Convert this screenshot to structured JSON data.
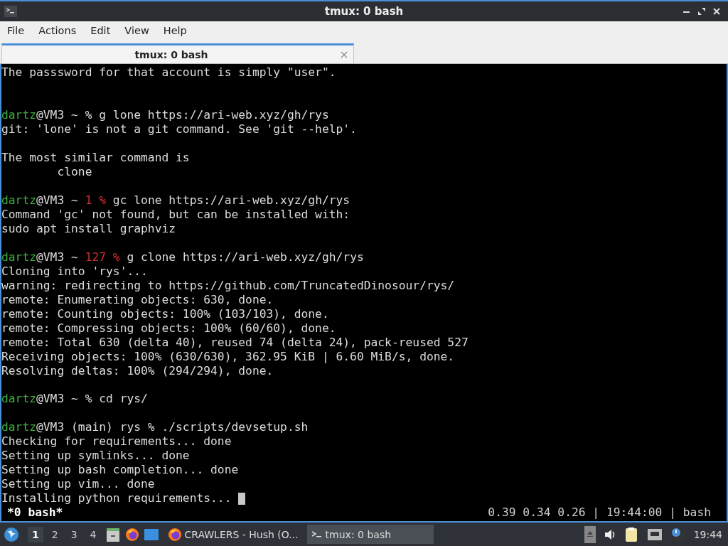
{
  "window": {
    "title": "tmux: 0 bash"
  },
  "menu": [
    "File",
    "Actions",
    "Edit",
    "View",
    "Help"
  ],
  "tabs": [
    {
      "label": "tmux: 0 bash",
      "selected": true
    }
  ],
  "terminal": {
    "lines": [
      {
        "kind": "text",
        "segments": [
          {
            "kind": "plain",
            "text": "The passsword for that account is simply \"user\"."
          }
        ]
      },
      {
        "kind": "blank"
      },
      {
        "kind": "blank"
      },
      {
        "kind": "text",
        "segments": [
          {
            "kind": "user",
            "text": "dartz"
          },
          {
            "kind": "plain",
            "text": "@VM3 ~ % g lone https://ari-web.xyz/gh/rys"
          }
        ]
      },
      {
        "kind": "text",
        "segments": [
          {
            "kind": "plain",
            "text": "git: 'lone' is not a git command. See 'git --help'."
          }
        ]
      },
      {
        "kind": "blank"
      },
      {
        "kind": "text",
        "segments": [
          {
            "kind": "plain",
            "text": "The most similar command is"
          }
        ]
      },
      {
        "kind": "text",
        "segments": [
          {
            "kind": "plain",
            "text": "        clone"
          }
        ]
      },
      {
        "kind": "blank"
      },
      {
        "kind": "text",
        "segments": [
          {
            "kind": "user",
            "text": "dartz"
          },
          {
            "kind": "plain",
            "text": "@VM3 ~ "
          },
          {
            "kind": "error",
            "text": "1 %"
          },
          {
            "kind": "plain",
            "text": " gc lone https://ari-web.xyz/gh/rys"
          }
        ]
      },
      {
        "kind": "text",
        "segments": [
          {
            "kind": "plain",
            "text": "Command 'gc' not found, but can be installed with:"
          }
        ]
      },
      {
        "kind": "text",
        "segments": [
          {
            "kind": "plain",
            "text": "sudo apt install graphviz"
          }
        ]
      },
      {
        "kind": "blank"
      },
      {
        "kind": "text",
        "segments": [
          {
            "kind": "user",
            "text": "dartz"
          },
          {
            "kind": "plain",
            "text": "@VM3 ~ "
          },
          {
            "kind": "error",
            "text": "127 %"
          },
          {
            "kind": "plain",
            "text": " g clone https://ari-web.xyz/gh/rys"
          }
        ]
      },
      {
        "kind": "text",
        "segments": [
          {
            "kind": "plain",
            "text": "Cloning into 'rys'..."
          }
        ]
      },
      {
        "kind": "text",
        "segments": [
          {
            "kind": "plain",
            "text": "warning: redirecting to https://github.com/TruncatedDinosour/rys/"
          }
        ]
      },
      {
        "kind": "text",
        "segments": [
          {
            "kind": "plain",
            "text": "remote: Enumerating objects: 630, done."
          }
        ]
      },
      {
        "kind": "text",
        "segments": [
          {
            "kind": "plain",
            "text": "remote: Counting objects: 100% (103/103), done."
          }
        ]
      },
      {
        "kind": "text",
        "segments": [
          {
            "kind": "plain",
            "text": "remote: Compressing objects: 100% (60/60), done."
          }
        ]
      },
      {
        "kind": "text",
        "segments": [
          {
            "kind": "plain",
            "text": "remote: Total 630 (delta 40), reused 74 (delta 24), pack-reused 527"
          }
        ]
      },
      {
        "kind": "text",
        "segments": [
          {
            "kind": "plain",
            "text": "Receiving objects: 100% (630/630), 362.95 KiB | 6.60 MiB/s, done."
          }
        ]
      },
      {
        "kind": "text",
        "segments": [
          {
            "kind": "plain",
            "text": "Resolving deltas: 100% (294/294), done."
          }
        ]
      },
      {
        "kind": "blank"
      },
      {
        "kind": "text",
        "segments": [
          {
            "kind": "user",
            "text": "dartz"
          },
          {
            "kind": "plain",
            "text": "@VM3 ~ % cd rys/"
          }
        ]
      },
      {
        "kind": "blank"
      },
      {
        "kind": "text",
        "segments": [
          {
            "kind": "user",
            "text": "dartz"
          },
          {
            "kind": "plain",
            "text": "@VM3 (main) rys % ./scripts/devsetup.sh"
          }
        ]
      },
      {
        "kind": "text",
        "segments": [
          {
            "kind": "plain",
            "text": "Checking for requirements... done"
          }
        ]
      },
      {
        "kind": "text",
        "segments": [
          {
            "kind": "plain",
            "text": "Setting up symlinks... done"
          }
        ]
      },
      {
        "kind": "text",
        "segments": [
          {
            "kind": "plain",
            "text": "Setting up bash completion... done"
          }
        ]
      },
      {
        "kind": "text",
        "segments": [
          {
            "kind": "plain",
            "text": "Setting up vim... done"
          }
        ]
      },
      {
        "kind": "prompt-cursor",
        "segments": [
          {
            "kind": "plain",
            "text": "Installing python requirements... "
          }
        ]
      }
    ],
    "status_bar": {
      "window": "*0 bash*",
      "info": "0.39 0.34 0.26 | 19:44:00 | bash"
    }
  },
  "taskbar": {
    "workspaces": [
      {
        "label": "1",
        "selected": true
      },
      {
        "label": "2",
        "selected": false
      },
      {
        "label": "3",
        "selected": false
      },
      {
        "label": "4",
        "selected": false
      }
    ],
    "tasks": [
      {
        "label": "CRAWLERS - Hush (O...",
        "kind": "browser",
        "selected": false
      },
      {
        "label": "tmux: 0 bash",
        "kind": "terminal",
        "selected": true
      }
    ],
    "clock": "19:44"
  }
}
